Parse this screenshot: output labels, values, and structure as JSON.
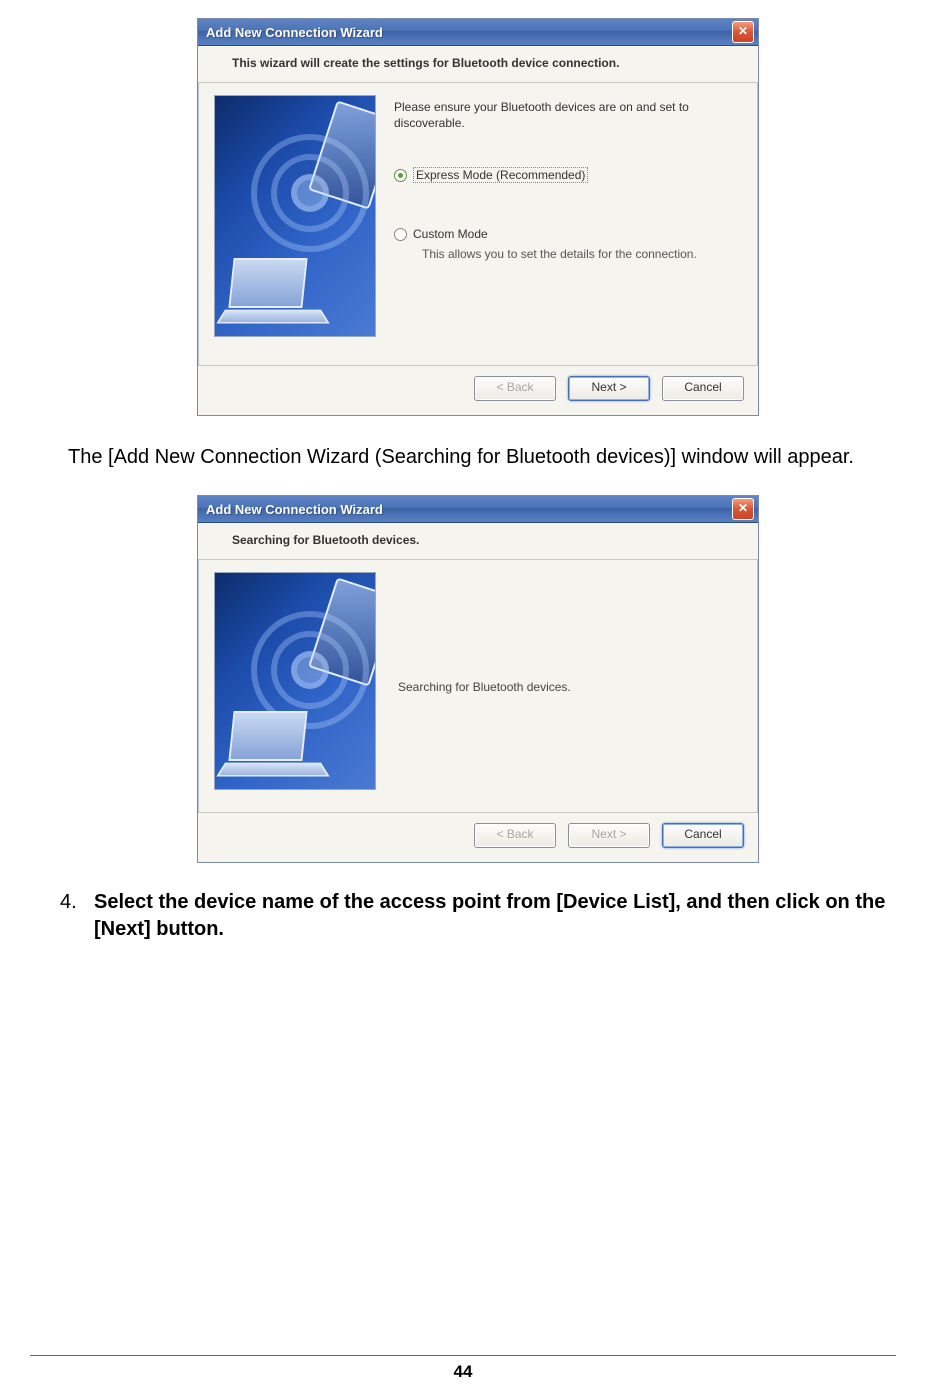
{
  "dialog1": {
    "title": "Add New Connection Wizard",
    "close_glyph": "✕",
    "subheader": "This wizard will create the settings for Bluetooth device connection.",
    "hint": "Please ensure your Bluetooth devices are on and set to discoverable.",
    "option1_label": "Express Mode (Recommended)",
    "option2_label": "Custom Mode",
    "option2_note": "This allows you to set the details for the connection.",
    "back": "< Back",
    "next": "Next >",
    "cancel": "Cancel"
  },
  "para1": "The [Add New Connection Wizard (Searching for Bluetooth devices)] window will appear.",
  "dialog2": {
    "title": "Add New Connection Wizard",
    "close_glyph": "✕",
    "subheader": "Searching for Bluetooth devices.",
    "status": "Searching for Bluetooth devices.",
    "back": "< Back",
    "next": "Next >",
    "cancel": "Cancel"
  },
  "step4_num": "4.",
  "step4_text": "Select the device name of the access point from [Device List], and then click on the [Next] button.",
  "page_number": "44"
}
